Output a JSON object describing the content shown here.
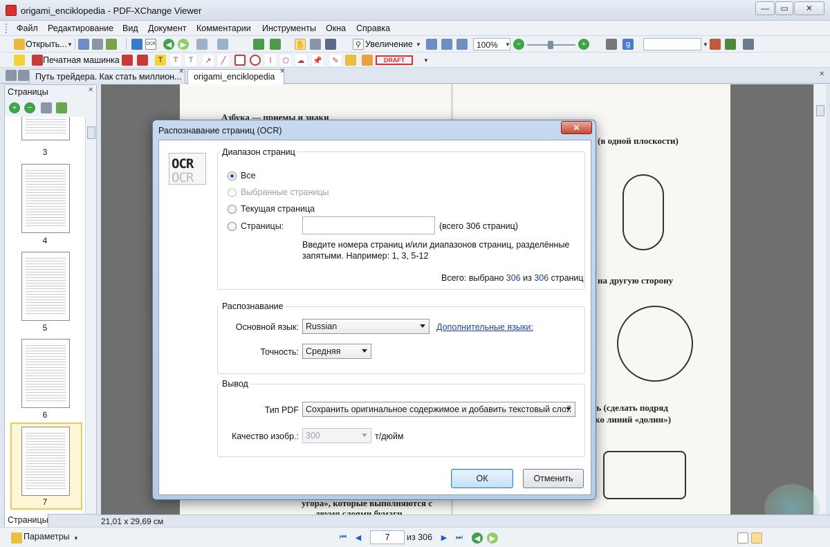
{
  "window": {
    "title": "origami_enciklopedia - PDF-XChange Viewer",
    "minimize": "—",
    "maximize": "▭",
    "close": "✕"
  },
  "menu": [
    "Файл",
    "Редактирование",
    "Вид",
    "Документ",
    "Комментарии",
    "Инструменты",
    "Окна",
    "Справка"
  ],
  "toolbar": {
    "open_label": "Открыть...",
    "zoom_in_label": "Увеличение",
    "zoom_value": "100%",
    "typewriter_label": "Печатная машинка",
    "stamp_label": "DRAFT"
  },
  "tabs": [
    {
      "label": "Путь трейдера. Как стать миллион..."
    },
    {
      "label": "origami_enciklopedia"
    }
  ],
  "pages_panel": {
    "title": "Страницы",
    "bottom_tab": "Страницы",
    "thumbnails": [
      "3",
      "4",
      "5",
      "6",
      "7"
    ]
  },
  "document": {
    "heading_top": "Азбука — приемы и знаки",
    "right_line1": "(в одной плоскости)",
    "right_line2": "на другую сторону",
    "right_line3": "ть (сделать подряд",
    "right_line4": "ко линий «долин»)",
    "bottom_line1": "угора», которые выполняются с",
    "bottom_line2": "двумя слоями бумаги"
  },
  "status": {
    "dimensions": "21,01 x 29,69 см"
  },
  "nav": {
    "params_label": "Параметры",
    "current_page": "7",
    "of_total": "из 306"
  },
  "dialog": {
    "title": "Распознавание страниц (OCR)",
    "close": "✕",
    "logo_top": "OCR",
    "logo_bottom": "OCR",
    "range": {
      "title": "Диапазон страниц",
      "all": "Все",
      "selected": "Выбранные страницы",
      "current": "Текущая страница",
      "pages": "Страницы:",
      "pages_value": "",
      "total_hint": "(всего 306 страниц)",
      "help_line1": "Введите номера страниц и/или диапазонов страниц, разделённые",
      "help_line2": "запятыми. Например: 1, 3, 5-12",
      "summary_prefix": "Всего: выбрано",
      "summary_selected": "306",
      "summary_of": "из",
      "summary_total": "306",
      "summary_suffix": "страниц"
    },
    "recognition": {
      "title": "Распознавание",
      "language_label": "Основной язык:",
      "language_value": "Russian",
      "extra_languages": "Дополнительные языки:",
      "accuracy_label": "Точность:",
      "accuracy_value": "Средняя"
    },
    "output": {
      "title": "Вывод",
      "pdf_type_label": "Тип PDF",
      "pdf_type_value": "Сохранить оригинальное содержимое и добавить текстовый слой",
      "quality_label": "Качество изобр.:",
      "quality_value": "300",
      "quality_unit": "т/дюйм"
    },
    "ok": "ОК",
    "cancel": "Отменить"
  },
  "colors": {
    "accent_blue": "#1a45a8",
    "close_red": "#c74834",
    "dialog_frame": "#b7cbe6"
  }
}
